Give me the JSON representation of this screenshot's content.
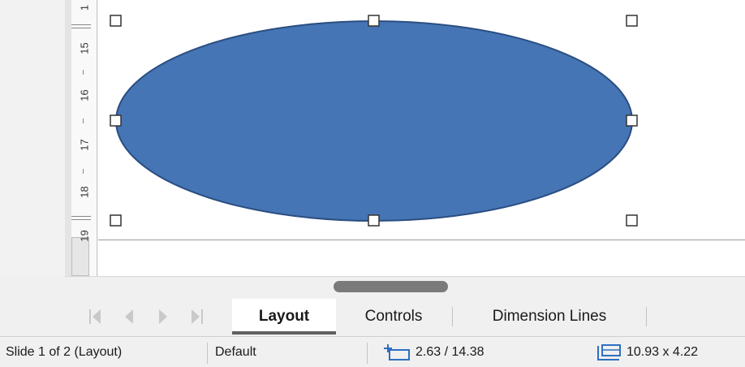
{
  "ruler": {
    "numbers": [
      "1",
      "15",
      "16",
      "17",
      "18",
      "19"
    ]
  },
  "tabs": {
    "items": [
      {
        "label": "Layout",
        "active": true
      },
      {
        "label": "Controls",
        "active": false
      },
      {
        "label": "Dimension Lines",
        "active": false
      }
    ]
  },
  "nav_icons": [
    "first-icon",
    "previous-icon",
    "next-icon",
    "last-icon"
  ],
  "statusbar": {
    "slide_info": "Slide 1 of 2 (Layout)",
    "master": "Default",
    "position": "2.63 / 14.38",
    "size": "10.93 x 4.22"
  },
  "colors": {
    "shape_fill": "#4575b4",
    "shape_stroke": "#2b4e82",
    "scroll_thumb": "#7a7a7a"
  }
}
